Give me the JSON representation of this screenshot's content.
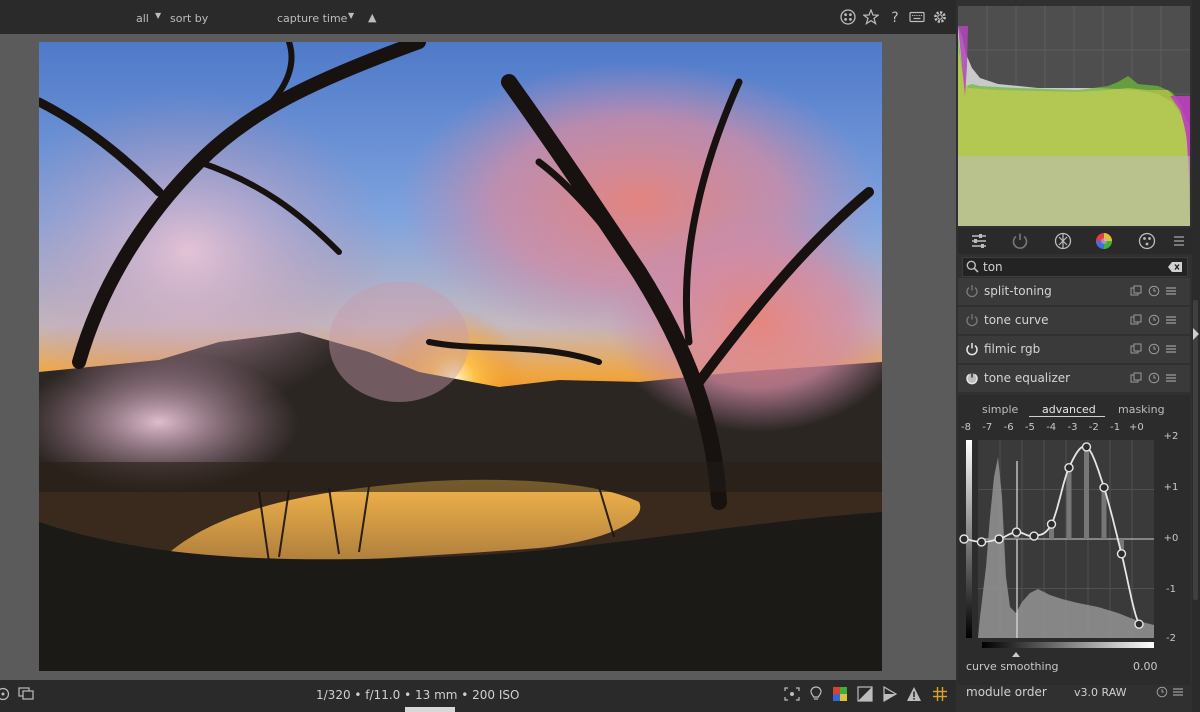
{
  "topbar": {
    "filter_label": "all",
    "sort_label": "sort by",
    "sort_value": "capture time",
    "sort_direction": "▲",
    "icons": [
      "overlay-icon",
      "star-icon",
      "help-icon",
      "keyboard-icon",
      "gear-icon"
    ]
  },
  "image": {
    "exif": "1/320 • f/11.0 • 13 mm • 200 ISO"
  },
  "bottombar": {
    "left_icons": [
      "color-picker-icon",
      "display-icon"
    ],
    "right_icons": [
      "focus-peaking-icon",
      "bulb-icon",
      "softproof-icon",
      "gamut-icon",
      "overexposure-icon",
      "clipping-warning-icon",
      "guides-icon"
    ]
  },
  "module_groups": {
    "icons": [
      "quick-access-icon",
      "active-modules-icon",
      "base-group-icon",
      "tone-group-icon",
      "color-group-icon",
      "effects-group-icon",
      "presets-menu-icon"
    ]
  },
  "search": {
    "value": "ton",
    "clear_icon": "clear-icon"
  },
  "modules": [
    {
      "name": "split-toning",
      "enabled": false
    },
    {
      "name": "tone curve",
      "enabled": false
    },
    {
      "name": "filmic rgb",
      "enabled": true
    },
    {
      "name": "tone equalizer",
      "enabled": true,
      "expanded": true
    }
  ],
  "tone_equalizer": {
    "tabs": [
      "simple",
      "advanced",
      "masking"
    ],
    "active_tab": "advanced",
    "ev_labels": [
      "-8",
      "-7",
      "-6",
      "-5",
      "-4",
      "-3",
      "-2",
      "-1",
      "+0"
    ],
    "y_labels": [
      "+2",
      "+1",
      "+0",
      "-1",
      "-2"
    ],
    "node_values": [
      0.0,
      -0.03,
      0.0,
      0.07,
      0.03,
      0.15,
      0.72,
      0.93,
      0.52,
      -0.15,
      -0.86
    ],
    "y_range": [
      -1,
      1
    ],
    "curve_smoothing_label": "curve smoothing",
    "curve_smoothing_value": "0.00"
  },
  "footer": {
    "module_order_label": "module order",
    "module_order_value": "v3.0 RAW"
  }
}
